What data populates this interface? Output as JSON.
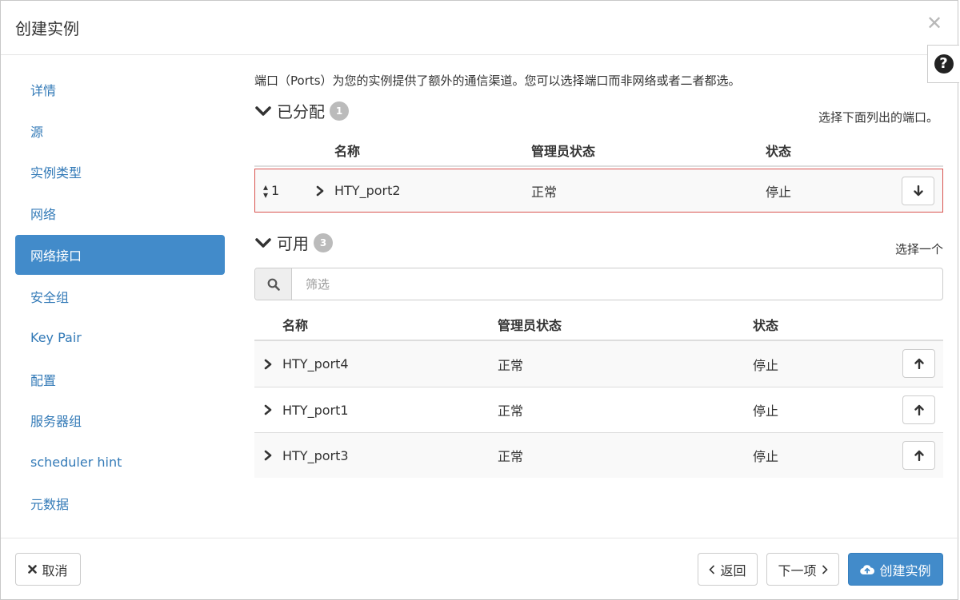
{
  "title": "创建实例",
  "nav": [
    "详情",
    "源",
    "实例类型",
    "网络",
    "网络接口",
    "安全组",
    "Key Pair",
    "配置",
    "服务器组",
    "scheduler hint",
    "元数据"
  ],
  "intro": "端口（Ports）为您的实例提供了额外的通信渠道。您可以选择端口而非网络或者二者都选。",
  "allocated": {
    "heading": "已分配",
    "count": "1",
    "note": "选择下面列出的端口。",
    "headers": [
      "名称",
      "管理员状态",
      "状态"
    ],
    "rows": [
      {
        "order": "1",
        "name": "HTY_port2",
        "admin": "正常",
        "status": "停止"
      }
    ]
  },
  "available": {
    "heading": "可用",
    "count": "3",
    "note": "选择一个",
    "filter_placeholder": "筛选",
    "headers": [
      "名称",
      "管理员状态",
      "状态"
    ],
    "rows": [
      {
        "name": "HTY_port4",
        "admin": "正常",
        "status": "停止"
      },
      {
        "name": "HTY_port1",
        "admin": "正常",
        "status": "停止"
      },
      {
        "name": "HTY_port3",
        "admin": "正常",
        "status": "停止"
      }
    ]
  },
  "footer": {
    "cancel": "取消",
    "back": "返回",
    "next": "下一项",
    "create": "创建实例"
  }
}
